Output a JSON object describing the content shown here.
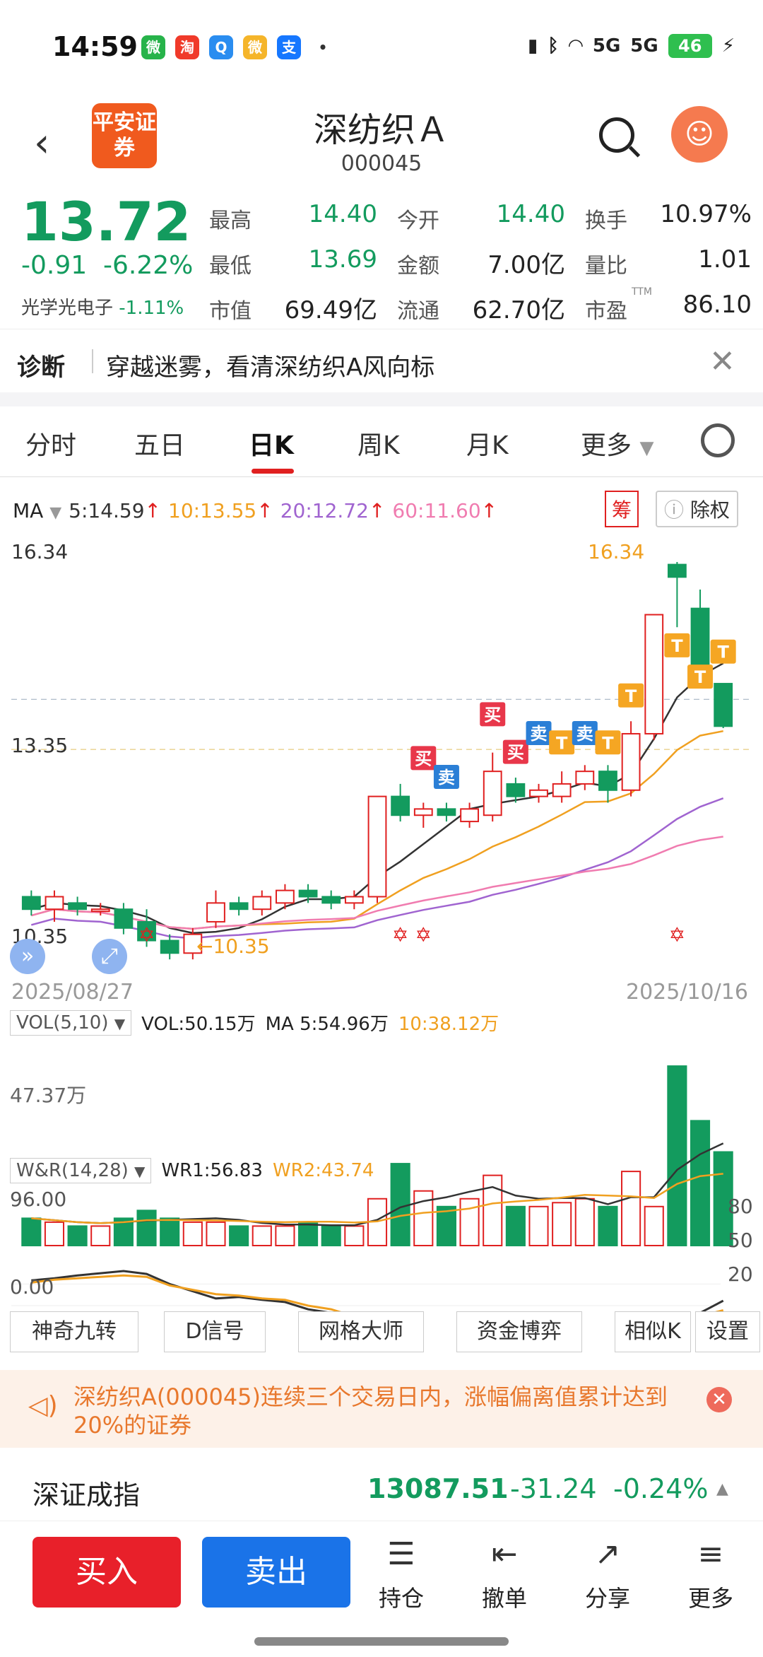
{
  "status": {
    "time": "14:59",
    "network1": "5G",
    "network2": "5G",
    "battery": "46"
  },
  "header": {
    "logo_text": "平安证券",
    "stock_name": "深纺织Ａ",
    "stock_code": "000045"
  },
  "quote": {
    "price": "13.72",
    "change": "-0.91",
    "change_pct": "-6.22%",
    "sector": "光学光电子",
    "sector_pct": "-1.11%",
    "fields": [
      {
        "label": "最高",
        "value": "14.40",
        "color": "#139b5e"
      },
      {
        "label": "今开",
        "value": "14.40",
        "color": "#139b5e"
      },
      {
        "label": "换手",
        "value": "10.97%",
        "color": "#222222"
      },
      {
        "label": "最低",
        "value": "13.69",
        "color": "#139b5e"
      },
      {
        "label": "金额",
        "value": "7.00亿",
        "color": "#222222"
      },
      {
        "label": "量比",
        "value": "1.01",
        "color": "#222222"
      },
      {
        "label": "市值",
        "value": "69.49亿",
        "color": "#222222"
      },
      {
        "label": "流通",
        "value": "62.70亿",
        "color": "#222222"
      },
      {
        "label": "市盈",
        "value": "86.10",
        "color": "#222222",
        "sup": "TTM"
      }
    ]
  },
  "diagnosis": {
    "title": "诊断",
    "text": "穿越迷雾，看清深纺织A风向标"
  },
  "tabs": [
    {
      "label": "分时",
      "active": false
    },
    {
      "label": "五日",
      "active": false
    },
    {
      "label": "日K",
      "active": true
    },
    {
      "label": "周K",
      "active": false
    },
    {
      "label": "月K",
      "active": false
    },
    {
      "label": "更多",
      "active": false
    }
  ],
  "chart": {
    "ma_label": "MA",
    "ma5": "5:14.59",
    "ma10": "10:13.55",
    "ma20": "20:12.72",
    "ma60": "60:11.60",
    "chip_btn": "筹",
    "exright_btn": "除权",
    "price_high": "16.34",
    "price_mid": "13.35",
    "price_low": "10.35",
    "peak_label": "16.34",
    "trough_label": "10.35",
    "date_start": "2025/08/27",
    "date_end": "2025/10/16",
    "vol_label": "VOL(5,10)",
    "vol_value": "VOL:50.15万",
    "vol_ma5": "MA 5:54.96万",
    "vol_ma10": "10:38.12万",
    "vol_axis": "47.37万",
    "wr_label": "W&R(14,28)",
    "wr1": "WR1:56.83",
    "wr2": "WR2:43.74",
    "wr_top": "96.00",
    "wr_bottom": "0.00",
    "wr_right": [
      "80",
      "50",
      "20"
    ],
    "buy_mark": "买",
    "sell_mark": "卖",
    "t_mark": "T",
    "colors": {
      "up": "#e02020",
      "down": "#139b5e",
      "ma5": "#333333",
      "ma10": "#f0a020",
      "ma20": "#a064d0",
      "ma60": "#f07cb0"
    }
  },
  "chart_data": {
    "type": "candlestick",
    "x": [
      "2025/08/27",
      "2025/10/16"
    ],
    "candles": [
      {
        "o": 11.0,
        "c": 10.8,
        "h": 11.1,
        "l": 10.7
      },
      {
        "o": 10.8,
        "c": 11.0,
        "h": 11.1,
        "l": 10.6
      },
      {
        "o": 10.9,
        "c": 10.8,
        "h": 11.0,
        "l": 10.7
      },
      {
        "o": 10.8,
        "c": 10.8,
        "h": 10.9,
        "l": 10.7
      },
      {
        "o": 10.8,
        "c": 10.5,
        "h": 10.9,
        "l": 10.4
      },
      {
        "o": 10.6,
        "c": 10.3,
        "h": 10.8,
        "l": 10.2
      },
      {
        "o": 10.3,
        "c": 10.1,
        "h": 10.4,
        "l": 10.0
      },
      {
        "o": 10.1,
        "c": 10.4,
        "h": 10.5,
        "l": 10.0
      },
      {
        "o": 10.6,
        "c": 10.9,
        "h": 11.1,
        "l": 10.5
      },
      {
        "o": 10.9,
        "c": 10.8,
        "h": 11.0,
        "l": 10.7
      },
      {
        "o": 10.8,
        "c": 11.0,
        "h": 11.1,
        "l": 10.7
      },
      {
        "o": 10.9,
        "c": 11.1,
        "h": 11.2,
        "l": 10.8
      },
      {
        "o": 11.1,
        "c": 11.0,
        "h": 11.2,
        "l": 10.9
      },
      {
        "o": 11.0,
        "c": 10.9,
        "h": 11.1,
        "l": 10.8
      },
      {
        "o": 10.9,
        "c": 11.0,
        "h": 11.1,
        "l": 10.8
      },
      {
        "o": 11.0,
        "c": 12.6,
        "h": 12.6,
        "l": 10.9
      },
      {
        "o": 12.6,
        "c": 12.3,
        "h": 12.8,
        "l": 12.2
      },
      {
        "o": 12.3,
        "c": 12.4,
        "h": 12.5,
        "l": 12.1
      },
      {
        "o": 12.4,
        "c": 12.3,
        "h": 12.5,
        "l": 12.2
      },
      {
        "o": 12.2,
        "c": 12.4,
        "h": 12.5,
        "l": 12.1
      },
      {
        "o": 12.3,
        "c": 13.0,
        "h": 13.3,
        "l": 12.2
      },
      {
        "o": 12.8,
        "c": 12.6,
        "h": 12.9,
        "l": 12.5
      },
      {
        "o": 12.6,
        "c": 12.7,
        "h": 12.8,
        "l": 12.5
      },
      {
        "o": 12.6,
        "c": 12.8,
        "h": 13.0,
        "l": 12.5
      },
      {
        "o": 12.8,
        "c": 13.0,
        "h": 13.1,
        "l": 12.7
      },
      {
        "o": 13.0,
        "c": 12.7,
        "h": 13.1,
        "l": 12.5
      },
      {
        "o": 12.7,
        "c": 13.6,
        "h": 13.8,
        "l": 12.6
      },
      {
        "o": 13.6,
        "c": 15.5,
        "h": 15.5,
        "l": 13.5
      },
      {
        "o": 16.3,
        "c": 16.1,
        "h": 16.34,
        "l": 15.3
      },
      {
        "o": 15.6,
        "c": 14.7,
        "h": 15.9,
        "l": 14.6
      },
      {
        "o": 14.4,
        "c": 13.72,
        "h": 14.4,
        "l": 13.69
      }
    ],
    "volume": [
      0.7,
      0.6,
      0.5,
      0.5,
      0.7,
      0.9,
      0.7,
      0.6,
      0.6,
      0.5,
      0.5,
      0.5,
      0.6,
      0.5,
      0.5,
      1.2,
      2.1,
      1.4,
      1.0,
      1.2,
      1.8,
      1.0,
      1.0,
      1.1,
      1.2,
      1.0,
      1.9,
      1.0,
      4.6,
      3.2,
      2.4
    ],
    "wr1": [
      85,
      88,
      92,
      95,
      98,
      94,
      80,
      70,
      60,
      62,
      58,
      55,
      45,
      40,
      30,
      15,
      10,
      18,
      20,
      18,
      16,
      22,
      25,
      24,
      22,
      18,
      10,
      5,
      5,
      40,
      56.83
    ],
    "wr2": [
      82,
      86,
      88,
      90,
      92,
      90,
      78,
      72,
      66,
      64,
      60,
      58,
      50,
      45,
      35,
      20,
      15,
      20,
      22,
      20,
      18,
      22,
      24,
      22,
      20,
      16,
      10,
      6,
      6,
      35,
      43.74
    ]
  },
  "tools": [
    "神奇九转",
    "D信号",
    "网格大师",
    "资金博弈",
    "相似K",
    "设置"
  ],
  "warning": {
    "text": "深纺织A(000045)连续三个交易日内，涨幅偏离值累计达到20%的证券"
  },
  "index": {
    "name": "深证成指",
    "value": "13087.51",
    "change": "-31.24",
    "change_pct": "-0.24%"
  },
  "bottom": {
    "buy": "买入",
    "sell": "卖出",
    "nav": [
      {
        "label": "持仓",
        "icon": "holdings-icon",
        "glyph": "☰"
      },
      {
        "label": "撤单",
        "icon": "withdraw-icon",
        "glyph": "⇤"
      },
      {
        "label": "分享",
        "icon": "share-icon",
        "glyph": "↗"
      },
      {
        "label": "更多",
        "icon": "more-icon",
        "glyph": "≡"
      }
    ]
  }
}
